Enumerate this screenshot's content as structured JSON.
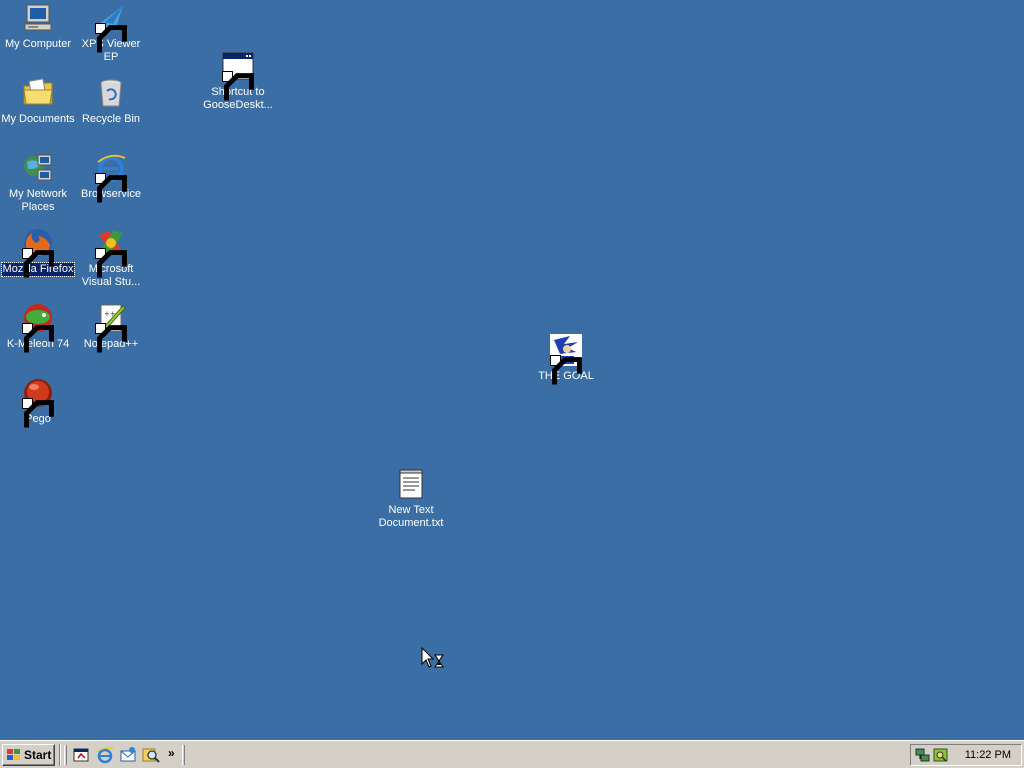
{
  "desktop": {
    "background_color": "#3a6ea5",
    "icons": {
      "my_computer": "My Computer",
      "xps_viewer": "XPS Viewer EP",
      "my_documents": "My Documents",
      "recycle_bin": "Recycle Bin",
      "network_places": "My Network Places",
      "browservice": "Browservice",
      "firefox": "Mozilla Firefox",
      "visual_studio": "Microsoft Visual Stu...",
      "kmeleon": "K-Meleon 74",
      "notepadpp": "Notepad++",
      "pego": "Pego",
      "goose_shortcut": "Shortcut to GooseDeskt...",
      "the_goal": "THE GOAL",
      "new_text_doc": "New Text Document.txt"
    },
    "selected_icon": "Mozilla Firefox"
  },
  "taskbar": {
    "start_label": "Start",
    "quick_launch": [
      "show-desktop-icon",
      "internet-explorer-icon",
      "outlook-express-icon",
      "search-icon"
    ],
    "more_label": "»",
    "clock": "11:22 PM",
    "tray_icons": [
      "network-icon",
      "security-icon"
    ]
  }
}
